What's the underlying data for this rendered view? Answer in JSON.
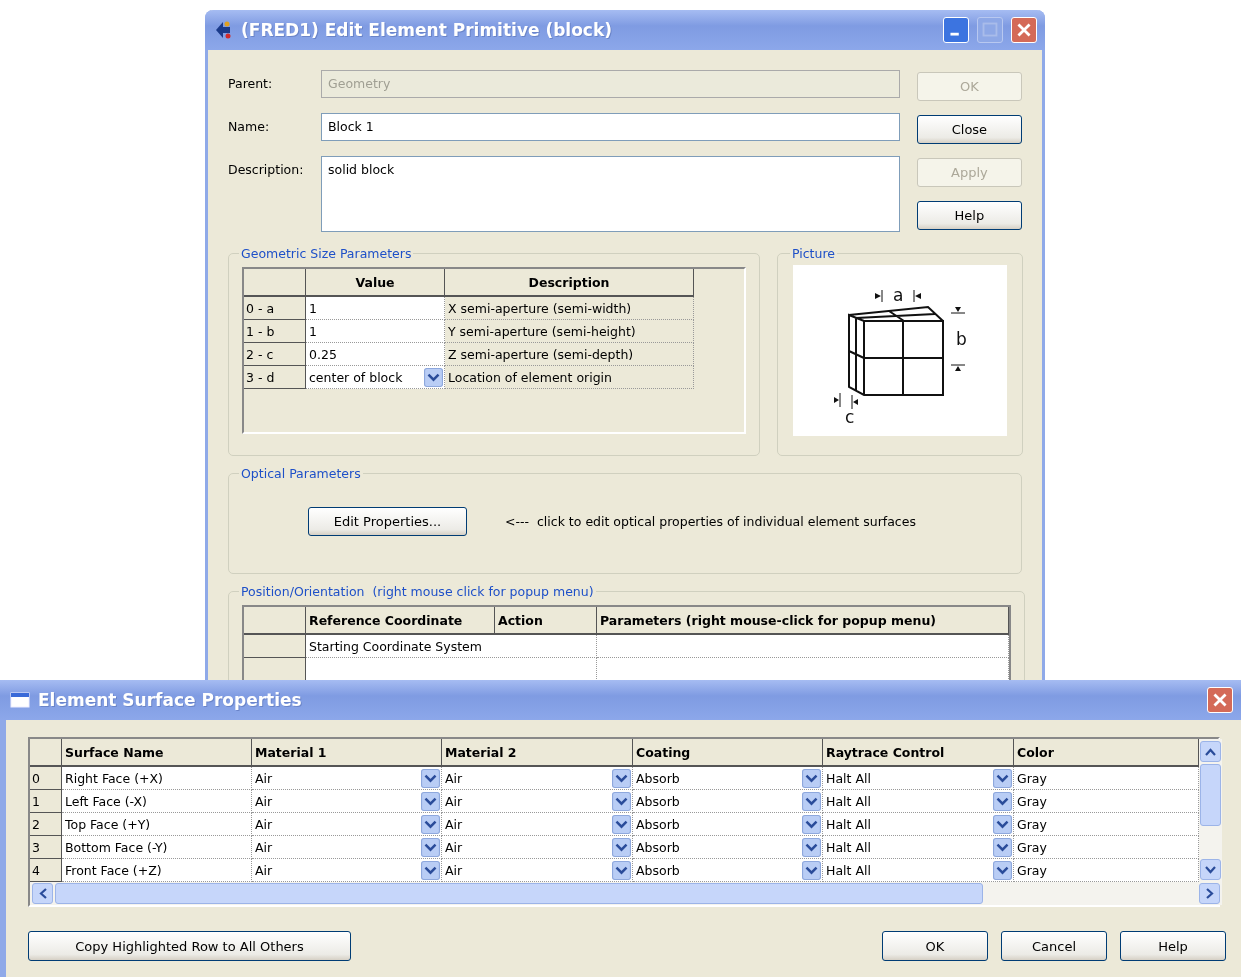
{
  "editor": {
    "title": "(FRED1) Edit Element Primitive (block)",
    "fields": [
      {
        "label": "Parent:",
        "value": "Geometry",
        "disabled": true,
        "kind": "line"
      },
      {
        "label": "Name:",
        "value": "Block 1",
        "disabled": false,
        "kind": "line"
      },
      {
        "label": "Description:",
        "value": "solid block",
        "disabled": false,
        "kind": "area"
      }
    ],
    "buttons": [
      {
        "label": "OK",
        "disabled": true
      },
      {
        "label": "Close",
        "disabled": false
      },
      {
        "label": "Apply",
        "disabled": true
      },
      {
        "label": "Help",
        "disabled": false
      }
    ],
    "geometry": {
      "title": "Geometric Size Parameters",
      "columns": [
        "Value",
        "Description"
      ],
      "rows": [
        {
          "index": "0 - a",
          "value": "1",
          "description": "X semi-aperture (semi-width)",
          "kind": "text"
        },
        {
          "index": "1 - b",
          "value": "1",
          "description": "Y semi-aperture (semi-height)",
          "kind": "text"
        },
        {
          "index": "2 - c",
          "value": "0.25",
          "description": "Z semi-aperture (semi-depth)",
          "kind": "text"
        },
        {
          "index": "3 - d",
          "value": "center of block",
          "description": "Location of element origin",
          "kind": "dropdown"
        }
      ]
    },
    "picture": {
      "title": "Picture",
      "labels": [
        "a",
        "b",
        "c"
      ]
    },
    "optical": {
      "title": "Optical Parameters",
      "button": "Edit Properties...",
      "hint": "<---  click to edit optical properties of individual element surfaces"
    },
    "position": {
      "title": "Position/Orientation  (right mouse click for popup menu)",
      "columns": [
        "Reference Coordinate",
        "Action",
        "Parameters (right mouse-click for popup menu)"
      ],
      "rows": [
        {
          "reference": "Starting Coordinate System"
        }
      ]
    }
  },
  "surfaces": {
    "title": "Element Surface Properties",
    "columns": [
      {
        "label": "Surface Name",
        "kind": "text"
      },
      {
        "label": "Material 1",
        "kind": "dropdown"
      },
      {
        "label": "Material 2",
        "kind": "dropdown"
      },
      {
        "label": "Coating",
        "kind": "dropdown"
      },
      {
        "label": "Raytrace Control",
        "kind": "dropdown"
      },
      {
        "label": "Color",
        "kind": "text"
      }
    ],
    "rows": [
      {
        "index": "0",
        "cells": [
          "Right Face (+X)",
          "Air",
          "Air",
          "Absorb",
          "Halt All",
          "Gray"
        ]
      },
      {
        "index": "1",
        "cells": [
          "Left Face (-X)",
          "Air",
          "Air",
          "Absorb",
          "Halt All",
          "Gray"
        ]
      },
      {
        "index": "2",
        "cells": [
          "Top Face (+Y)",
          "Air",
          "Air",
          "Absorb",
          "Halt All",
          "Gray"
        ]
      },
      {
        "index": "3",
        "cells": [
          "Bottom Face (-Y)",
          "Air",
          "Air",
          "Absorb",
          "Halt All",
          "Gray"
        ]
      },
      {
        "index": "4",
        "cells": [
          "Front Face (+Z)",
          "Air",
          "Air",
          "Absorb",
          "Halt All",
          "Gray"
        ]
      }
    ],
    "copy_button": "Copy Highlighted Row to All Others",
    "buttons": [
      "OK",
      "Cancel",
      "Help"
    ]
  }
}
